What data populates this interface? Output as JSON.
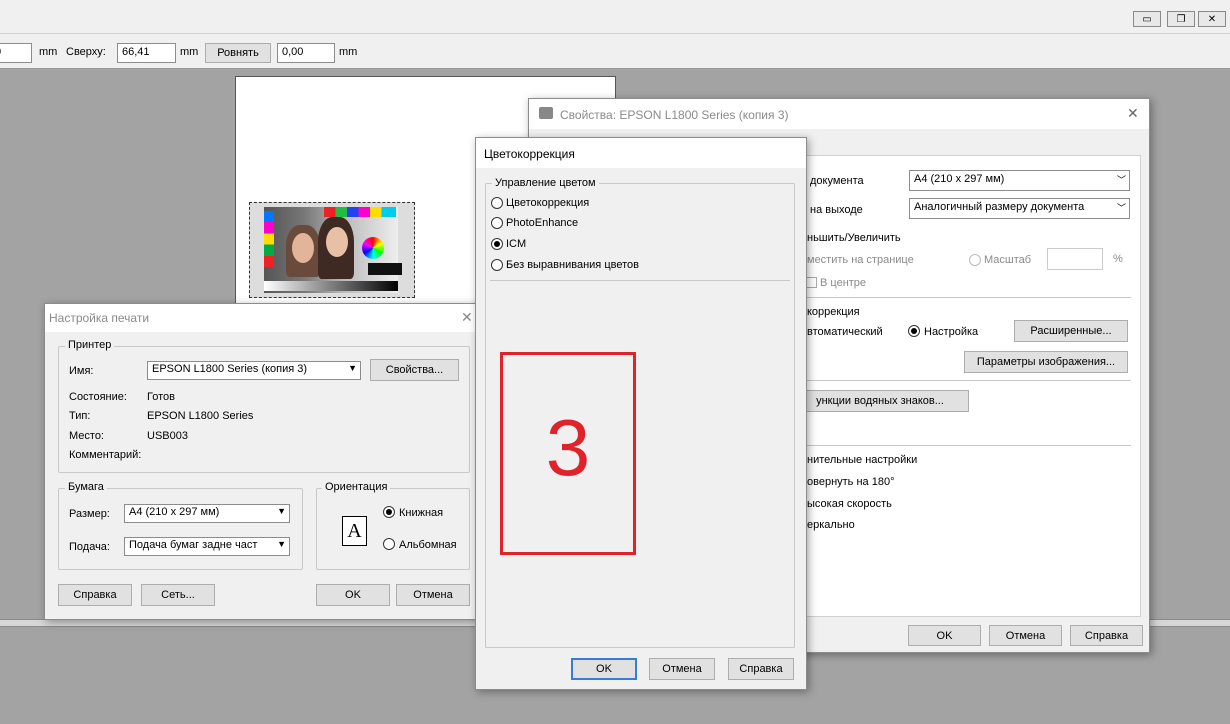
{
  "window": {
    "min": "▭",
    "restore": "❐",
    "close": "✕"
  },
  "toolbar": {
    "left_value": "0",
    "unit1": "mm",
    "top_label": "Сверху:",
    "top_value": "66,41",
    "unit2": "mm",
    "align_button": "Ровнять",
    "offset_value": "0,00",
    "unit3": "mm"
  },
  "properties": {
    "title": "Свойства: EPSON L1800 Series (копия 3)",
    "doc_label": "документа",
    "doc_value": "A4 (210 x 297 мм)",
    "out_label": "на выходе",
    "out_value": "Аналогичный размеру документа",
    "scale_heading": "ньшить/Увеличить",
    "fit_page": "местить на странице",
    "scale_radio": "Масштаб",
    "percent": "%",
    "center": "В центре",
    "color_heading": "коррекция",
    "auto": "втоматический",
    "custom": "Настройка",
    "advanced_button": "Расширенные...",
    "image_params_button": "Параметры изображения...",
    "watermark_button": "ункции водяных знаков...",
    "extra_heading": "нительные настройки",
    "rotate": "овернуть на 180°",
    "high_speed": "ысокая скорость",
    "mirror": "еркально",
    "ok": "OK",
    "cancel": "Отмена",
    "help": "Справка"
  },
  "print_setup": {
    "title": "Настройка печати",
    "printer_group": "Принтер",
    "name_label": "Имя:",
    "name_value": "EPSON L1800 Series (копия 3)",
    "properties_button": "Свойства...",
    "status_label": "Состояние:",
    "status_value": "Готов",
    "type_label": "Тип:",
    "type_value": "EPSON L1800 Series",
    "location_label": "Место:",
    "location_value": "USB003",
    "comment_label": "Комментарий:",
    "paper_group": "Бумага",
    "size_label": "Размер:",
    "size_value": "A4 (210 x 297 мм)",
    "source_label": "Подача:",
    "source_value": "Подача бумаг задне част",
    "orientation_group": "Ориентация",
    "portrait": "Книжная",
    "landscape": "Альбомная",
    "orientation_icon_letter": "A",
    "help": "Справка",
    "network": "Сеть...",
    "ok": "OK",
    "cancel": "Отмена"
  },
  "color_dialog": {
    "title": "Цветокоррекция",
    "group": "Управление цветом",
    "options": [
      "Цветокоррекция",
      "PhotoEnhance",
      "ICM",
      "Без выравнивания цветов"
    ],
    "selected": "ICM",
    "marker": "3",
    "ok": "OK",
    "cancel": "Отмена",
    "help": "Справка"
  },
  "colors": {
    "marker_red": "#e0222a",
    "focus_blue": "#3a7bd5",
    "dialog_bg": "#f0f0f0",
    "workspace": "#a3a3a3"
  }
}
